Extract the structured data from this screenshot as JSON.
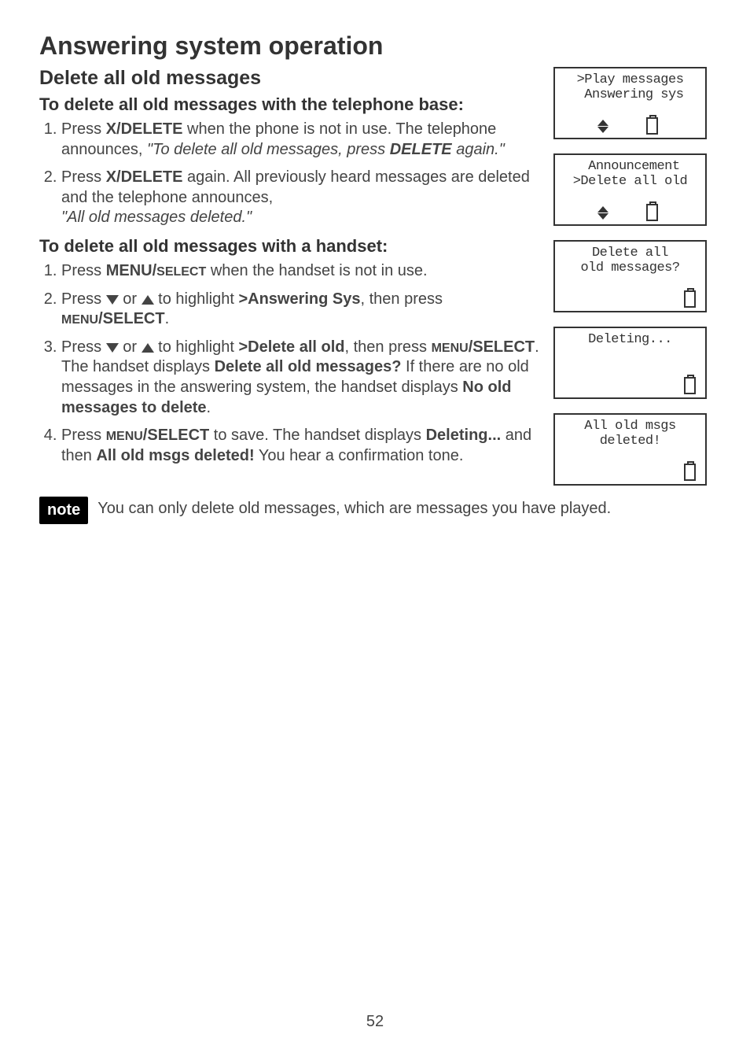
{
  "title": "Answering system operation",
  "section_heading": "Delete all old messages",
  "subhead_base": "To delete all old messages with the telephone base:",
  "base_steps": {
    "s1a": "Press ",
    "s1b": "X/DELETE",
    "s1c": " when the phone is not in use. The telephone announces, ",
    "s1d": "\"To delete all old messages, press ",
    "s1e": "DELETE",
    "s1f": " again.\"",
    "s2a": "Press ",
    "s2b": "X/DELETE",
    "s2c": " again. All previously heard messages are deleted and the telephone announces,",
    "s2d": "\"All old messages deleted.\""
  },
  "subhead_handset": "To delete all old messages with a handset:",
  "handset_steps": {
    "h1a": "Press ",
    "h1b": "MENU/",
    "h1bs": "SELECT",
    "h1c": " when the handset is not in use.",
    "h2a": "Press ",
    "h2b": " or ",
    "h2c": " to highlight ",
    "h2d": ">Answering Sys",
    "h2e": ", then press ",
    "h2f": "MENU",
    "h2g": "/SELECT",
    "h2h": ".",
    "h3a": "Press ",
    "h3b": " or ",
    "h3c": " to highlight ",
    "h3d": ">Delete all old",
    "h3e": ", then press ",
    "h3f": "MENU",
    "h3g": "/SELECT",
    "h3h": ". The handset displays ",
    "h3i": "Delete all old messages?",
    "h3j": " If there are no old messages in the answering system, the handset displays ",
    "h3k": "No old messages to delete",
    "h3l": ".",
    "h4a": "Press ",
    "h4b": "MENU",
    "h4c": "/SELECT",
    "h4d": " to save. The handset displays ",
    "h4e": "Deleting...",
    "h4f": " and then ",
    "h4g": "All old msgs deleted!",
    "h4h": " You hear a confirmation tone."
  },
  "note_label": "note",
  "note_text": "You can only delete old messages, which are messages you have played.",
  "screens": {
    "s1": {
      "l1": ">Play messages",
      "l2": " Answering sys"
    },
    "s2": {
      "l1": " Announcement",
      "l2": ">Delete all old"
    },
    "s3": {
      "l1": "Delete all",
      "l2": "old messages?"
    },
    "s4": {
      "l1": "Deleting...",
      "l2": ""
    },
    "s5": {
      "l1": "All old msgs",
      "l2": "deleted!"
    }
  },
  "page_number": "52"
}
